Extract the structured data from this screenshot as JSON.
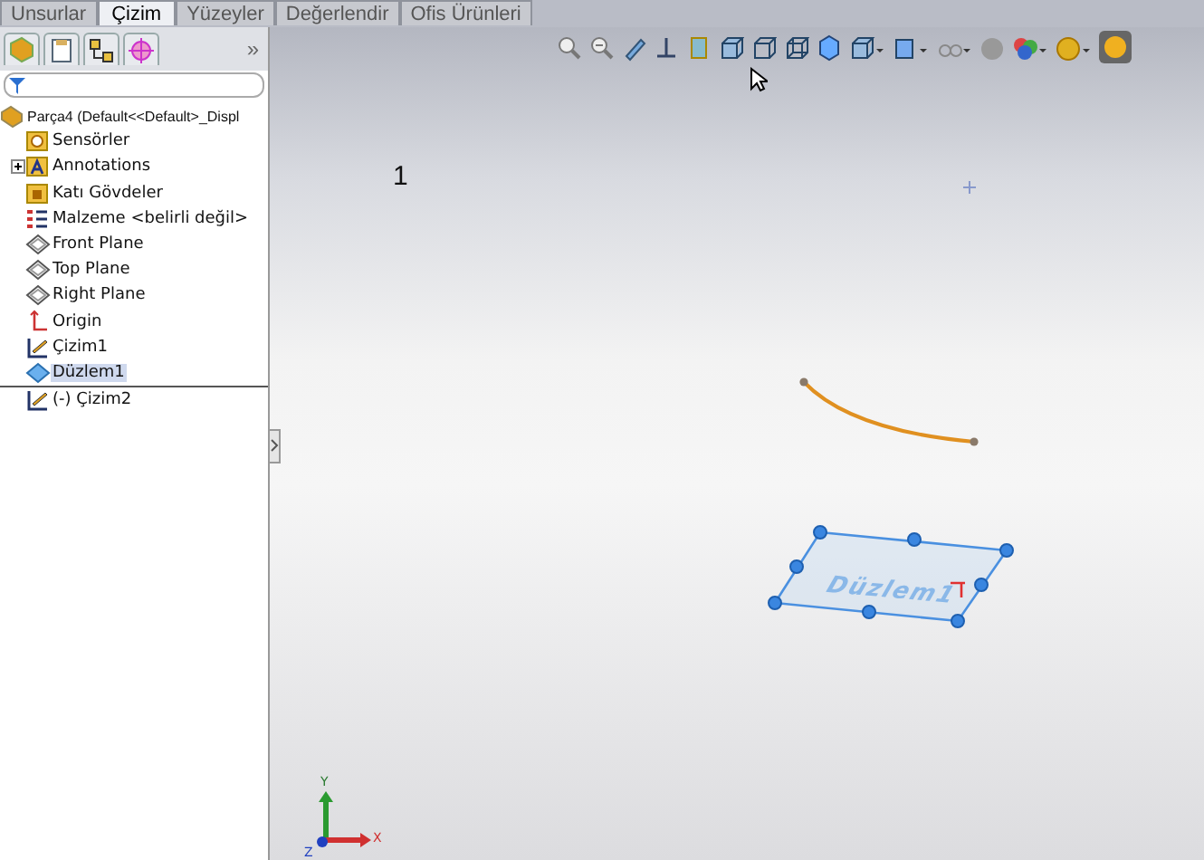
{
  "command_tabs": [
    {
      "label": "Unsurlar",
      "selected": false
    },
    {
      "label": "Çizim",
      "selected": true
    },
    {
      "label": "Yüzeyler",
      "selected": false
    },
    {
      "label": "Değerlendir",
      "selected": false
    },
    {
      "label": "Ofis Ürünleri",
      "selected": false
    }
  ],
  "panel": {
    "more": "»",
    "tree": {
      "label": "Parça4  (Default<<Default>_Displ",
      "kind": "part",
      "children": [
        {
          "label": "Sensörler",
          "kind": "sensors",
          "selected": false
        },
        {
          "label": "Annotations",
          "kind": "annotations",
          "selected": false,
          "expanded": false
        },
        {
          "label": "Katı Gövdeler",
          "kind": "bodies",
          "selected": false
        },
        {
          "label": "Malzeme <belirli değil>",
          "kind": "material",
          "selected": false
        },
        {
          "label": "Front Plane",
          "kind": "plane",
          "selected": false
        },
        {
          "label": "Top Plane",
          "kind": "plane",
          "selected": false
        },
        {
          "label": "Right Plane",
          "kind": "plane",
          "selected": false
        },
        {
          "label": "Origin",
          "kind": "origin",
          "selected": false
        },
        {
          "label": "Çizim1",
          "kind": "sketch",
          "selected": false
        },
        {
          "label": "Düzlem1",
          "kind": "refplane",
          "selected": true
        }
      ]
    },
    "rolled_back": [
      {
        "label": "(-) Çizim2",
        "kind": "sketch",
        "selected": false
      }
    ]
  },
  "viewport": {
    "marker": "1",
    "plane_label": "Düzlem1",
    "axes": {
      "y": "Y",
      "x": "X",
      "z": "Z"
    }
  }
}
